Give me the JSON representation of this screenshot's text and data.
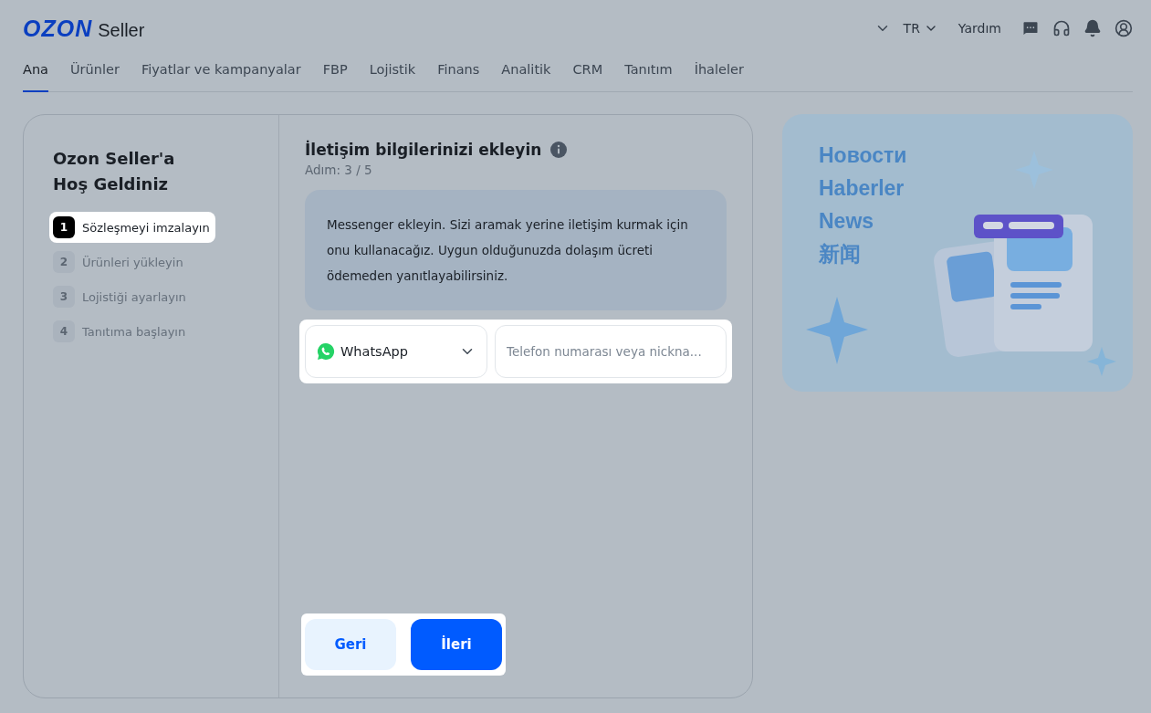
{
  "header": {
    "logo": {
      "brand": "OZON",
      "product": "Seller"
    },
    "language": "TR",
    "help": "Yardım"
  },
  "nav": [
    {
      "label": "Ana",
      "selected": true
    },
    {
      "label": "Ürünler",
      "selected": false
    },
    {
      "label": "Fiyatlar ve kampanyalar",
      "selected": false
    },
    {
      "label": "FBP",
      "selected": false
    },
    {
      "label": "Lojistik",
      "selected": false
    },
    {
      "label": "Finans",
      "selected": false
    },
    {
      "label": "Analitik",
      "selected": false
    },
    {
      "label": "CRM",
      "selected": false
    },
    {
      "label": "Tanıtım",
      "selected": false
    },
    {
      "label": "İhaleler",
      "selected": false
    }
  ],
  "onboarding": {
    "title_lines": [
      "Ozon Seller'a",
      "Hoş Geldiniz"
    ],
    "steps": [
      {
        "number": "1",
        "label": "Sözleşmeyi imzalayın",
        "selected": true
      },
      {
        "number": "2",
        "label": "Ürünleri yükleyin",
        "selected": false
      },
      {
        "number": "3",
        "label": "Lojistiği ayarlayın",
        "selected": false
      },
      {
        "number": "4",
        "label": "Tanıtıma başlayın",
        "selected": false
      }
    ],
    "step_title": "İletişim bilgilerinizi ekleyin",
    "step_counter": "Adım: 3 / 5",
    "message": "Messenger ekleyin. Sizi aramak yerine iletişim kurmak için onu kullanacağız. Uygun olduğunuzda dolaşım ücreti ödemeden yanıtlayabilirsiniz.",
    "messenger": "WhatsApp",
    "phone_placeholder": "Telefon numarası veya nickna...",
    "buttons": [
      {
        "kind": "secondary",
        "label": "Geri"
      },
      {
        "kind": "primary",
        "label": "İleri"
      }
    ]
  },
  "news": {
    "lines": [
      "Новости",
      "Haberler",
      "News",
      "新闻"
    ]
  }
}
